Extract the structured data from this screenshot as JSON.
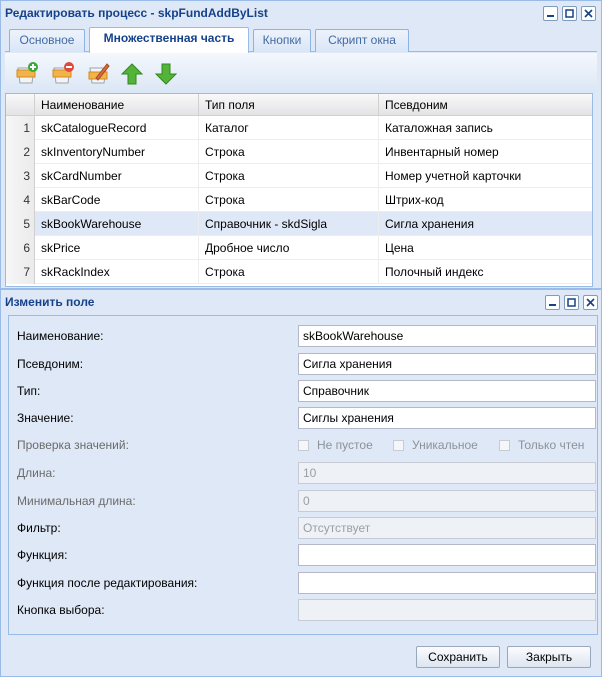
{
  "main_window": {
    "title": "Редактировать процесс - skpFundAddByList",
    "tabs": [
      "Основное",
      "Множественная часть",
      "Кнопки",
      "Скрипт окна"
    ],
    "active_tab": 1,
    "toolbar_icons": [
      "add-row-icon",
      "remove-row-icon",
      "edit-row-icon",
      "arrow-up-icon",
      "arrow-down-icon"
    ],
    "grid": {
      "columns": [
        "Наименование",
        "Тип поля",
        "Псевдоним"
      ],
      "rows": [
        {
          "num": "1",
          "name": "skCatalogueRecord",
          "type": "Каталог",
          "alias": "Каталожная запись"
        },
        {
          "num": "2",
          "name": "skInventoryNumber",
          "type": "Строка",
          "alias": "Инвентарный номер"
        },
        {
          "num": "3",
          "name": "skCardNumber",
          "type": "Строка",
          "alias": "Номер учетной карточки"
        },
        {
          "num": "4",
          "name": "skBarCode",
          "type": "Строка",
          "alias": "Штрих-код"
        },
        {
          "num": "5",
          "name": "skBookWarehouse",
          "type": "Справочник - skdSigla",
          "alias": "Сигла хранения",
          "selected": true
        },
        {
          "num": "6",
          "name": "skPrice",
          "type": "Дробное число",
          "alias": "Цена"
        },
        {
          "num": "7",
          "name": "skRackIndex",
          "type": "Строка",
          "alias": "Полочный индекс"
        }
      ]
    }
  },
  "edit_window": {
    "title": "Изменить поле",
    "fields": {
      "name": {
        "label": "Наименование:",
        "value": "skBookWarehouse"
      },
      "alias": {
        "label": "Псевдоним:",
        "value": "Сигла хранения"
      },
      "type": {
        "label": "Тип:",
        "value": "Справочник"
      },
      "value": {
        "label": "Значение:",
        "value": "Сиглы хранения"
      },
      "validation": {
        "label": "Проверка значений:",
        "options": [
          "Не пустое",
          "Уникальное",
          "Только чтен"
        ]
      },
      "length": {
        "label": "Длина:",
        "value": "10"
      },
      "min_length": {
        "label": "Минимальная длина:",
        "value": "0"
      },
      "filter": {
        "label": "Фильтр:",
        "value": "Отсутствует"
      },
      "function": {
        "label": "Функция:",
        "value": ""
      },
      "function_after_edit": {
        "label": "Функция после редактирования:",
        "value": ""
      },
      "select_button": {
        "label": "Кнопка выбора:",
        "value": ""
      }
    },
    "buttons": {
      "save": "Сохранить",
      "close": "Закрыть"
    }
  },
  "colors": {
    "title_text": "#15428b",
    "panel_bg": "#dfe8f6",
    "border": "#99bbe8",
    "selected_row": "#dfe8f6"
  }
}
